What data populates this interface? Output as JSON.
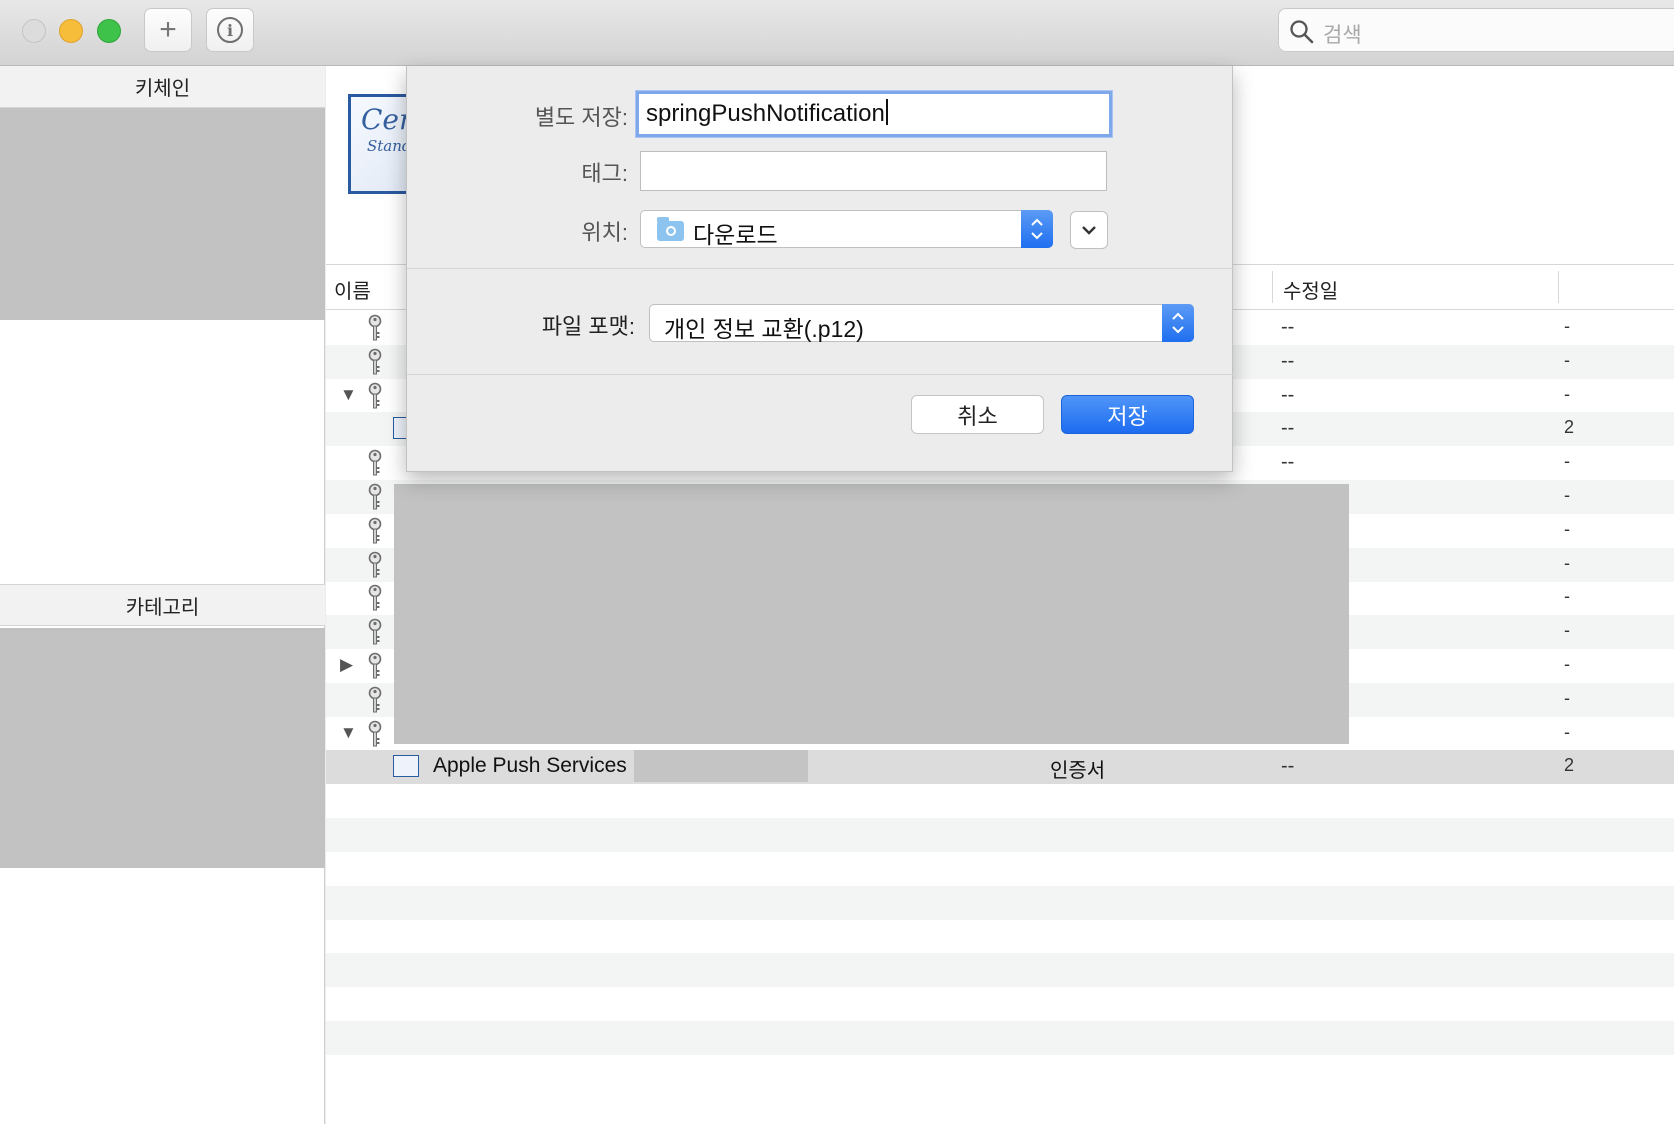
{
  "window": {
    "add_label": "+",
    "info_label": "i",
    "search_placeholder": "검색"
  },
  "sidebar": {
    "keychain_header": "키체인",
    "category_header": "카테고리"
  },
  "table": {
    "columns": {
      "name": "이름",
      "modified": "수정일"
    },
    "rows": [
      {
        "indent": 0,
        "disclosure": "",
        "icon": "key-icon",
        "name": "",
        "kind": "",
        "modified": "--",
        "edge": "-"
      },
      {
        "indent": 0,
        "disclosure": "",
        "icon": "key-icon",
        "name": "",
        "kind": "",
        "modified": "--",
        "edge": "-"
      },
      {
        "indent": 0,
        "disclosure": "expanded",
        "icon": "key-icon",
        "name": "",
        "kind": "",
        "modified": "--",
        "edge": "-"
      },
      {
        "indent": 1,
        "disclosure": "",
        "icon": "certificate-icon",
        "name": "",
        "kind": "",
        "modified": "--",
        "edge": "2"
      },
      {
        "indent": 0,
        "disclosure": "",
        "icon": "key-icon",
        "name": "",
        "kind": "",
        "modified": "--",
        "edge": "-"
      },
      {
        "indent": 0,
        "disclosure": "",
        "icon": "key-icon",
        "name": "",
        "kind": "",
        "modified": "",
        "edge": "-"
      },
      {
        "indent": 0,
        "disclosure": "",
        "icon": "key-icon",
        "name": "",
        "kind": "",
        "modified": "",
        "edge": "-"
      },
      {
        "indent": 0,
        "disclosure": "",
        "icon": "key-icon",
        "name": "",
        "kind": "",
        "modified": "",
        "edge": "-"
      },
      {
        "indent": 0,
        "disclosure": "",
        "icon": "key-icon",
        "name": "",
        "kind": "",
        "modified": "",
        "edge": "-"
      },
      {
        "indent": 0,
        "disclosure": "",
        "icon": "key-icon",
        "name": "",
        "kind": "",
        "modified": "",
        "edge": "-"
      },
      {
        "indent": 0,
        "disclosure": "collapsed",
        "icon": "key-icon",
        "name": "",
        "kind": "",
        "modified": "",
        "edge": "-"
      },
      {
        "indent": 0,
        "disclosure": "",
        "icon": "key-icon",
        "name": "",
        "kind": "",
        "modified": "",
        "edge": "-"
      },
      {
        "indent": 0,
        "disclosure": "expanded",
        "icon": "key-icon",
        "name": "",
        "kind": "",
        "modified": "",
        "edge": "-"
      },
      {
        "indent": 1,
        "disclosure": "",
        "icon": "certificate-icon",
        "name": "Apple Push Services",
        "kind": "인증서",
        "modified": "--",
        "edge": "2",
        "selected": true
      }
    ]
  },
  "dialog": {
    "save_as_label": "별도 저장:",
    "save_as_value": "springPushNotification",
    "tags_label": "태그:",
    "tags_value": "",
    "location_label": "위치:",
    "location_value": "다운로드",
    "format_label": "파일 포맷:",
    "format_value": "개인 정보 교환(.p12)",
    "cancel_label": "취소",
    "save_label": "저장"
  },
  "colors": {
    "accent": "#1d6cf0",
    "redaction": "#c2c2c2"
  }
}
